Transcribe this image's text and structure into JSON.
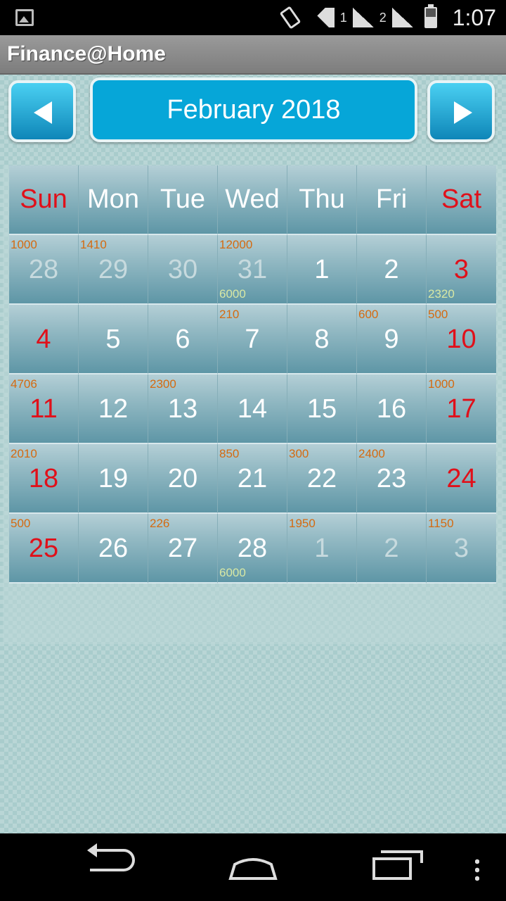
{
  "status_bar": {
    "time": "1:07",
    "sim1": "1",
    "sim2": "2"
  },
  "app": {
    "title": "Finance@Home"
  },
  "nav": {
    "month_label": "February 2018"
  },
  "calendar": {
    "weekdays": [
      {
        "label": "Sun",
        "weekend": true
      },
      {
        "label": "Mon",
        "weekend": false
      },
      {
        "label": "Tue",
        "weekend": false
      },
      {
        "label": "Wed",
        "weekend": false
      },
      {
        "label": "Thu",
        "weekend": false
      },
      {
        "label": "Fri",
        "weekend": false
      },
      {
        "label": "Sat",
        "weekend": true
      }
    ],
    "weeks": [
      [
        {
          "day": "28",
          "muted": true,
          "red": false,
          "top": "1000",
          "bottom": ""
        },
        {
          "day": "29",
          "muted": true,
          "red": false,
          "top": "1410",
          "bottom": ""
        },
        {
          "day": "30",
          "muted": true,
          "red": false,
          "top": "",
          "bottom": ""
        },
        {
          "day": "31",
          "muted": true,
          "red": false,
          "top": "12000",
          "bottom": "6000"
        },
        {
          "day": "1",
          "muted": false,
          "red": false,
          "top": "",
          "bottom": ""
        },
        {
          "day": "2",
          "muted": false,
          "red": false,
          "top": "",
          "bottom": ""
        },
        {
          "day": "3",
          "muted": false,
          "red": true,
          "top": "",
          "bottom": "2320"
        }
      ],
      [
        {
          "day": "4",
          "muted": false,
          "red": true,
          "top": "",
          "bottom": ""
        },
        {
          "day": "5",
          "muted": false,
          "red": false,
          "top": "",
          "bottom": ""
        },
        {
          "day": "6",
          "muted": false,
          "red": false,
          "top": "",
          "bottom": ""
        },
        {
          "day": "7",
          "muted": false,
          "red": false,
          "top": "210",
          "bottom": ""
        },
        {
          "day": "8",
          "muted": false,
          "red": false,
          "top": "",
          "bottom": ""
        },
        {
          "day": "9",
          "muted": false,
          "red": false,
          "top": "600",
          "bottom": ""
        },
        {
          "day": "10",
          "muted": false,
          "red": true,
          "top": "500",
          "bottom": ""
        }
      ],
      [
        {
          "day": "11",
          "muted": false,
          "red": true,
          "top": "4706",
          "bottom": ""
        },
        {
          "day": "12",
          "muted": false,
          "red": false,
          "top": "",
          "bottom": ""
        },
        {
          "day": "13",
          "muted": false,
          "red": false,
          "top": "2300",
          "bottom": ""
        },
        {
          "day": "14",
          "muted": false,
          "red": false,
          "top": "",
          "bottom": ""
        },
        {
          "day": "15",
          "muted": false,
          "red": false,
          "top": "",
          "bottom": ""
        },
        {
          "day": "16",
          "muted": false,
          "red": false,
          "top": "",
          "bottom": ""
        },
        {
          "day": "17",
          "muted": false,
          "red": true,
          "top": "1000",
          "bottom": ""
        }
      ],
      [
        {
          "day": "18",
          "muted": false,
          "red": true,
          "top": "2010",
          "bottom": ""
        },
        {
          "day": "19",
          "muted": false,
          "red": false,
          "top": "",
          "bottom": ""
        },
        {
          "day": "20",
          "muted": false,
          "red": false,
          "top": "",
          "bottom": ""
        },
        {
          "day": "21",
          "muted": false,
          "red": false,
          "top": "850",
          "bottom": ""
        },
        {
          "day": "22",
          "muted": false,
          "red": false,
          "top": "300",
          "bottom": ""
        },
        {
          "day": "23",
          "muted": false,
          "red": false,
          "top": "2400",
          "bottom": ""
        },
        {
          "day": "24",
          "muted": false,
          "red": true,
          "top": "",
          "bottom": ""
        }
      ],
      [
        {
          "day": "25",
          "muted": false,
          "red": true,
          "top": "500",
          "bottom": ""
        },
        {
          "day": "26",
          "muted": false,
          "red": false,
          "top": "",
          "bottom": ""
        },
        {
          "day": "27",
          "muted": false,
          "red": false,
          "top": "226",
          "bottom": ""
        },
        {
          "day": "28",
          "muted": false,
          "red": false,
          "top": "",
          "bottom": "6000"
        },
        {
          "day": "1",
          "muted": true,
          "red": false,
          "top": "1950",
          "bottom": ""
        },
        {
          "day": "2",
          "muted": true,
          "red": false,
          "top": "",
          "bottom": ""
        },
        {
          "day": "3",
          "muted": true,
          "red": false,
          "top": "1150",
          "bottom": ""
        }
      ]
    ]
  },
  "icons": {
    "gallery": "image-icon",
    "rotate": "screen-rotate-icon",
    "wifi": "wifi-icon",
    "signal": "signal-icon",
    "battery": "battery-icon",
    "prev": "arrow-left-icon",
    "next": "arrow-right-icon",
    "back": "back-icon",
    "home": "home-icon",
    "recent": "recent-apps-icon",
    "menu": "overflow-menu-icon"
  },
  "colors": {
    "accent": "#06a6d8",
    "weekend": "#e0101a",
    "income": "#d46a10",
    "expense": "#d8e8a4"
  }
}
